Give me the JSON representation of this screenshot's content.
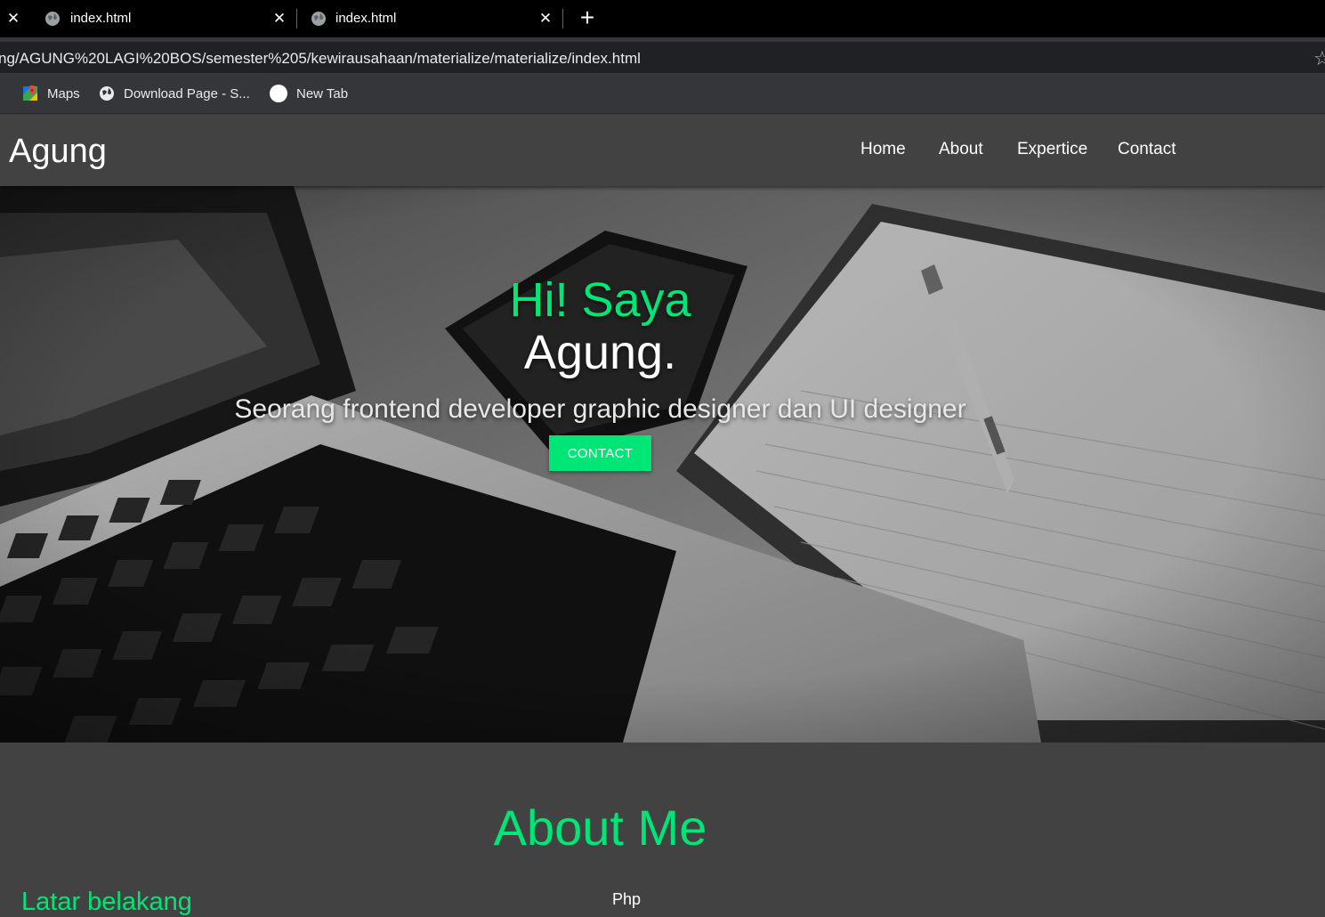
{
  "browser": {
    "tabs": [
      {
        "title": "index.html"
      },
      {
        "title": "index.html"
      }
    ],
    "url": "ng/AGUNG%20LAGI%20BOS/semester%205/kewirausahaan/materialize/materialize/index.html",
    "bookmarks": [
      {
        "label": "Maps",
        "icon": "google-maps-icon"
      },
      {
        "label": "Download Page - S...",
        "icon": "globe-icon"
      },
      {
        "label": "New Tab",
        "icon": "circle-icon"
      }
    ]
  },
  "navbar": {
    "brand": "Agung",
    "links": [
      "Home",
      "About",
      "Expertice",
      "Contact"
    ]
  },
  "hero": {
    "greeting": "Hi! Saya",
    "name": "Agung.",
    "subtitle": "Seorang frontend developer graphic designer dan UI designer",
    "button": "CONTACT"
  },
  "about": {
    "title": "About Me",
    "left_heading": "Latar belakang",
    "right_item": "Php"
  },
  "colors": {
    "accent": "#00e676",
    "background": "#424242",
    "navbar": "#424242"
  }
}
